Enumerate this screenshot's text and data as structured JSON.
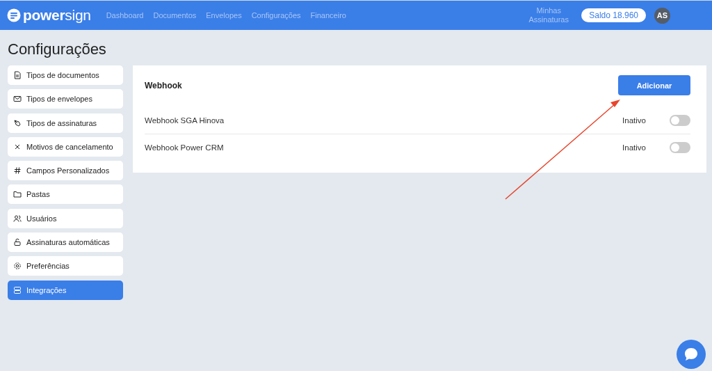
{
  "header": {
    "logo": {
      "bold": "power",
      "light": "sign"
    },
    "nav": [
      {
        "label": "Dashboard"
      },
      {
        "label": "Documentos"
      },
      {
        "label": "Envelopes"
      },
      {
        "label": "Configurações"
      },
      {
        "label": "Financeiro"
      }
    ],
    "my_signatures": "Minhas Assinaturas",
    "balance": "Saldo 18.960",
    "avatar": "AS"
  },
  "page_title": "Configurações",
  "sidebar": {
    "items": [
      {
        "label": "Tipos de documentos",
        "kind": "document",
        "selected": false
      },
      {
        "label": "Tipos de envelopes",
        "kind": "envelope",
        "selected": false
      },
      {
        "label": "Tipos de assinaturas",
        "kind": "pen",
        "selected": false
      },
      {
        "label": "Motivos de cancelamento",
        "kind": "cross",
        "selected": false
      },
      {
        "label": "Campos Personalizados",
        "kind": "hash",
        "selected": false
      },
      {
        "label": "Pastas",
        "kind": "folder",
        "selected": false
      },
      {
        "label": "Usuários",
        "kind": "users",
        "selected": false
      },
      {
        "label": "Assinaturas automáticas",
        "kind": "lock",
        "selected": false
      },
      {
        "label": "Preferências",
        "kind": "gear",
        "selected": false
      },
      {
        "label": "Integrações",
        "kind": "server",
        "selected": true
      }
    ]
  },
  "panel": {
    "title": "Webhook",
    "add_button": "Adicionar",
    "webhooks": [
      {
        "name": "Webhook SGA Hinova",
        "status": "Inativo",
        "on": false
      },
      {
        "name": "Webhook Power CRM",
        "status": "Inativo",
        "on": false
      }
    ]
  }
}
